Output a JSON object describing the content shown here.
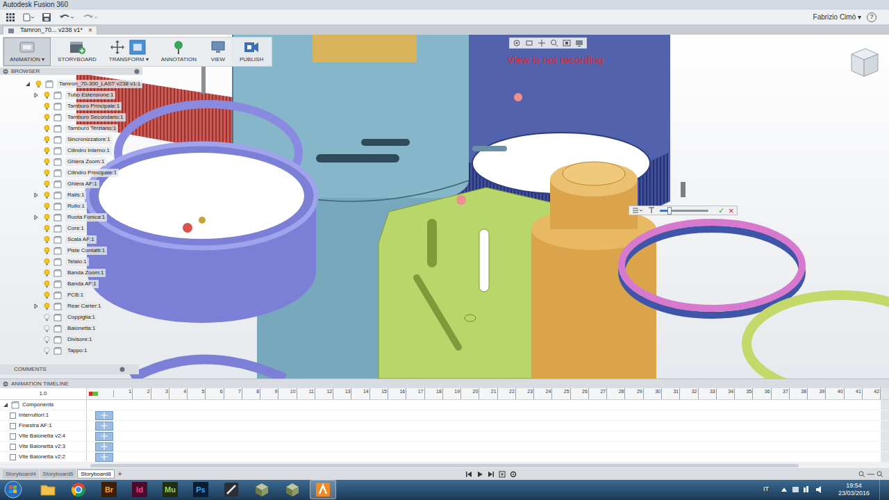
{
  "window": {
    "title": "Autodesk Fusion 360"
  },
  "account": {
    "user": "Fabrizio Cimò ▾",
    "help": "?"
  },
  "document_tab": {
    "label": "Tamron_70... v238 v1*",
    "close": "×",
    "selected": true
  },
  "ribbon": [
    {
      "label": "ANIMATION ▾",
      "selected": true
    },
    {
      "label": "STORYBOARD",
      "selected": false
    },
    {
      "label": "TRANSFORM ▾",
      "selected": false
    },
    {
      "label": "ANNOTATION",
      "selected": false
    },
    {
      "label": "VIEW",
      "selected": false
    },
    {
      "label": "PUBLISH",
      "selected": false
    }
  ],
  "viewport": {
    "recording_notice": "View is not recording",
    "manipulator": {
      "level": 0.2,
      "confirm": "✓",
      "cancel": "×"
    }
  },
  "browser": {
    "title": "BROWSER",
    "root": {
      "label": "Tamron_70-300_LAST v238 v1:1",
      "expanded": true
    },
    "items": [
      {
        "label": "Tubo Estensione:1",
        "expandable": true,
        "visible": true
      },
      {
        "label": "Tamburo Principale:1",
        "expandable": false,
        "visible": true
      },
      {
        "label": "Tamburo Secondario:1",
        "expandable": false,
        "visible": true
      },
      {
        "label": "Tamburo Terziario:1",
        "expandable": false,
        "visible": true
      },
      {
        "label": "Sincronizzatore:1",
        "expandable": false,
        "visible": true
      },
      {
        "label": "Cilindro Interno:1",
        "expandable": false,
        "visible": true
      },
      {
        "label": "Ghiera Zoom:1",
        "expandable": false,
        "visible": true
      },
      {
        "label": "Cilindro Principale:1",
        "expandable": false,
        "visible": true
      },
      {
        "label": "Ghiera AF:1",
        "expandable": false,
        "visible": true
      },
      {
        "label": "Rails:1",
        "expandable": true,
        "visible": true
      },
      {
        "label": "Rullo:1",
        "expandable": false,
        "visible": true
      },
      {
        "label": "Ruota Fonica:1",
        "expandable": true,
        "visible": true
      },
      {
        "label": "Core:1",
        "expandable": false,
        "visible": true
      },
      {
        "label": "Scala AF:1",
        "expandable": false,
        "visible": true
      },
      {
        "label": "Piste Contatti:1",
        "expandable": false,
        "visible": true
      },
      {
        "label": "Telaio:1",
        "expandable": false,
        "visible": true
      },
      {
        "label": "Banda Zoom:1",
        "expandable": false,
        "visible": true
      },
      {
        "label": "Banda AF:1",
        "expandable": false,
        "visible": true
      },
      {
        "label": "PCB:1",
        "expandable": false,
        "visible": true
      },
      {
        "label": "Rear Carter:1",
        "expandable": true,
        "visible": true
      },
      {
        "label": "Coppiglia:1",
        "expandable": false,
        "visible": false
      },
      {
        "label": "Baionetta:1",
        "expandable": false,
        "visible": false
      },
      {
        "label": "Divisore:1",
        "expandable": false,
        "visible": false
      },
      {
        "label": "Tappo:1",
        "expandable": false,
        "visible": false
      }
    ]
  },
  "comments": {
    "title": "COMMENTS"
  },
  "timeline": {
    "title": "ANIMATION TIMELINE",
    "speed": "1.0",
    "ticks": [
      "1",
      "2",
      "3",
      "4",
      "5",
      "6",
      "7",
      "8",
      "9",
      "10",
      "11",
      "12",
      "13",
      "14",
      "15",
      "16",
      "17",
      "18",
      "19",
      "20",
      "21",
      "22",
      "23",
      "24",
      "25",
      "26",
      "27",
      "28",
      "29",
      "30",
      "31",
      "32",
      "33",
      "34",
      "35",
      "36",
      "37",
      "38",
      "39",
      "40",
      "41",
      "42"
    ],
    "group": {
      "label": "Components",
      "expanded": true
    },
    "rows": [
      {
        "label": "Interruttori:1"
      },
      {
        "label": "Finestra AF:1"
      },
      {
        "label": "Vite Baionetta v2:4"
      },
      {
        "label": "Vite Baionetta v2:3"
      },
      {
        "label": "Vite Baionetta v2:2"
      }
    ]
  },
  "storyboards": [
    {
      "label": "Storyboard4",
      "selected": false
    },
    {
      "label": "Storyboard6",
      "selected": false
    },
    {
      "label": "Storyboard8",
      "selected": true
    }
  ],
  "add_storyboard": "+",
  "taskbar": {
    "apps": [
      {
        "kind": "folder",
        "selected": false
      },
      {
        "kind": "chrome",
        "selected": false
      },
      {
        "kind": "badge",
        "label": "Br",
        "color": "#3a1f04",
        "selected": false
      },
      {
        "kind": "badge",
        "label": "Id",
        "color": "#4a0a2a",
        "selected": false
      },
      {
        "kind": "badge",
        "label": "Mu",
        "color": "#1f2d12",
        "selected": false
      },
      {
        "kind": "badge",
        "label": "Ps",
        "color": "#061e36",
        "selected": false
      },
      {
        "kind": "tool",
        "selected": false
      },
      {
        "kind": "cube",
        "selected": false
      },
      {
        "kind": "cube",
        "selected": false
      },
      {
        "kind": "fusion",
        "selected": true
      }
    ],
    "language": "IT",
    "time": "19:54",
    "date": "23/03/2016"
  }
}
